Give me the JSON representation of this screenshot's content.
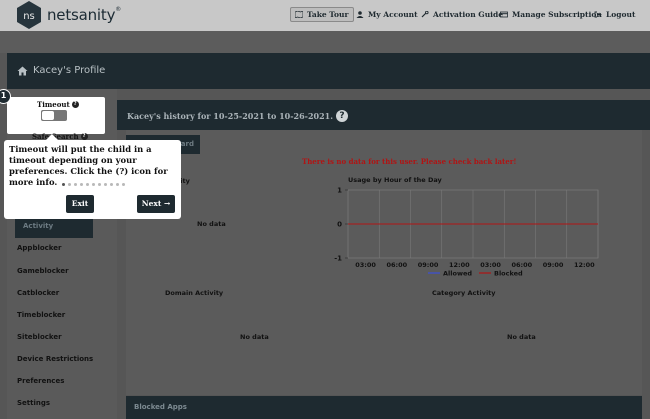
{
  "app": {
    "brand": "netsanity",
    "trademark": "®"
  },
  "nav": {
    "tour_label": "Take Tour",
    "account_label": "My Account",
    "activation_label": "Activation Guide",
    "subscription_label": "Manage Subscription",
    "logout_label": "Logout"
  },
  "profile": {
    "title": "Kacey's Profile"
  },
  "history": {
    "title": "Kacey's history for 10-25-2021 to 10-26-2021.",
    "help": "?",
    "dashboard_btn_partial": "oard",
    "no_data_message": "There is no data for this user. Please check back later!"
  },
  "sidebar": {
    "items": [
      {
        "label": "Safe Search"
      },
      {
        "label": "Activity"
      },
      {
        "label": "Appblocker"
      },
      {
        "label": "Gameblocker"
      },
      {
        "label": "Catblocker"
      },
      {
        "label": "Timeblocker"
      },
      {
        "label": "Siteblocker"
      },
      {
        "label": "Device Restrictions"
      },
      {
        "label": "Preferences"
      },
      {
        "label": "Settings"
      }
    ]
  },
  "panels": {
    "device_activity_partial": "vity",
    "device_nodata": "No data",
    "domain_title": "Domain Activity",
    "domain_nodata": "No data",
    "category_title": "Category Activity",
    "category_nodata": "No data",
    "blocked_apps": "Blocked Apps"
  },
  "tour": {
    "step": "1",
    "spot_label": "Timeout",
    "spot_help": "?",
    "safe_search_label": "Safe Search",
    "safe_search_help": "?",
    "text": "Timeout will put the child in a timeout depending on your preferences. Click the (?) icon for more info.",
    "exit_label": "Exit",
    "next_label": "Next →",
    "dots_total": 11,
    "dot_active": 1
  },
  "colors": {
    "dark_panel": "#1e2a30",
    "allowed": "#3b4fd8",
    "blocked": "#b01414"
  },
  "chart_data": {
    "type": "line",
    "title": "Usage by Hour of the Day",
    "x": [
      "03:00",
      "06:00",
      "09:00",
      "12:00",
      "03:00",
      "06:00",
      "09:00",
      "12:00"
    ],
    "ylim": [
      -1,
      1
    ],
    "yticks": [
      1,
      0,
      -1
    ],
    "grid": true,
    "legend": "bottom",
    "series": [
      {
        "name": "Allowed",
        "values": [
          0,
          0,
          0,
          0,
          0,
          0,
          0,
          0
        ]
      },
      {
        "name": "Blocked",
        "values": [
          0,
          0,
          0,
          0,
          0,
          0,
          0,
          0
        ]
      }
    ]
  }
}
